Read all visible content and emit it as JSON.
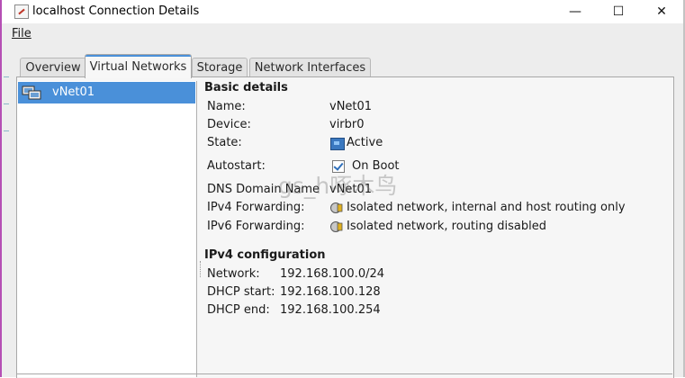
{
  "window": {
    "title": "localhost Connection Details",
    "controls": {
      "minimize": "—",
      "maximize": "☐",
      "close": "✕"
    }
  },
  "menu": {
    "file": "File"
  },
  "tabs": [
    {
      "label": "Overview"
    },
    {
      "label": "Virtual Networks"
    },
    {
      "label": "Storage"
    },
    {
      "label": "Network Interfaces"
    }
  ],
  "networks": [
    {
      "name": "vNet01"
    }
  ],
  "basic_details": {
    "title": "Basic details",
    "name_label": "Name:",
    "name_value": "vNet01",
    "device_label": "Device:",
    "device_value": "virbr0",
    "state_label": "State:",
    "state_value": "Active",
    "autostart_label": "Autostart:",
    "autostart_value": "On Boot",
    "dns_label": "DNS Domain Name",
    "dns_value": "vNet01",
    "ipv4_fwd_label": "IPv4 Forwarding:",
    "ipv4_fwd_value": "Isolated network, internal and host routing only",
    "ipv6_fwd_label": "IPv6 Forwarding:",
    "ipv6_fwd_value": "Isolated network, routing disabled"
  },
  "ipv4_config": {
    "title": "IPv4 configuration",
    "network_label": "Network:",
    "network_value": "192.168.100.0/24",
    "dhcp_start_label": "DHCP start:",
    "dhcp_start_value": "192.168.100.128",
    "dhcp_end_label": "DHCP end:",
    "dhcp_end_value": "192.168.100.254"
  },
  "watermark": "gs_h啄木鸟",
  "colors": {
    "selection": "#4a90d9",
    "accent_border": "#b54fb4"
  }
}
